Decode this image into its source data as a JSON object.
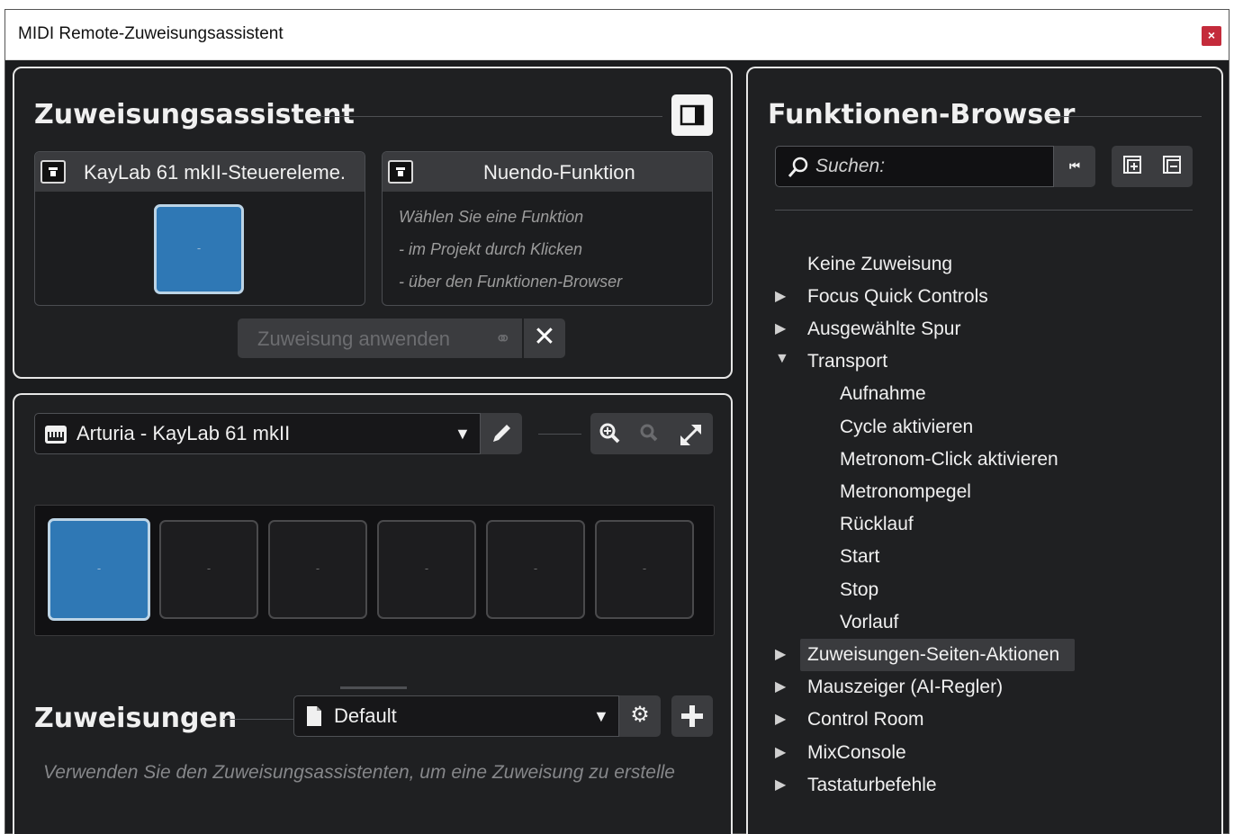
{
  "window": {
    "title": "MIDI Remote-Zuweisungsassistent",
    "close_label": "×"
  },
  "assistant": {
    "title": "Zuweisungsassistent",
    "controller_box": {
      "title": "KayLab 61 mkII-Steuereleme.",
      "pad_value": "-"
    },
    "function_box": {
      "title": "Nuendo-Funktion",
      "hints": [
        "Wählen Sie eine Funktion",
        "- im Projekt durch Klicken",
        "- über den Funktionen-Browser"
      ]
    },
    "apply_label": "Zuweisung anwenden"
  },
  "device": {
    "selected": "Arturia - KayLab 61 mkII",
    "pads": [
      {
        "value": "-",
        "active": true
      },
      {
        "value": "-",
        "active": false
      },
      {
        "value": "-",
        "active": false
      },
      {
        "value": "-",
        "active": false
      },
      {
        "value": "-",
        "active": false
      },
      {
        "value": "-",
        "active": false
      }
    ]
  },
  "mappings": {
    "title": "Zuweisungen",
    "page_selected": "Default",
    "empty_hint": "Verwenden Sie den Zuweisungsassistenten, um eine Zuweisung zu erstelle"
  },
  "browser": {
    "title": "Funktionen-Browser",
    "search_placeholder": "Suchen:",
    "items": [
      {
        "label": "Keine Zuweisung",
        "level": 0,
        "arrow": "none"
      },
      {
        "label": "Focus Quick Controls",
        "level": 0,
        "arrow": "collapsed"
      },
      {
        "label": "Ausgewählte Spur",
        "level": 0,
        "arrow": "collapsed"
      },
      {
        "label": "Transport",
        "level": 0,
        "arrow": "expanded"
      },
      {
        "label": "Aufnahme",
        "level": 1,
        "arrow": "none"
      },
      {
        "label": "Cycle aktivieren",
        "level": 1,
        "arrow": "none"
      },
      {
        "label": "Metronom-Click aktivieren",
        "level": 1,
        "arrow": "none"
      },
      {
        "label": "Metronompegel",
        "level": 1,
        "arrow": "none"
      },
      {
        "label": "Rücklauf",
        "level": 1,
        "arrow": "none"
      },
      {
        "label": "Start",
        "level": 1,
        "arrow": "none"
      },
      {
        "label": "Stop",
        "level": 1,
        "arrow": "none"
      },
      {
        "label": "Vorlauf",
        "level": 1,
        "arrow": "none"
      },
      {
        "label": "Zuweisungen-Seiten-Aktionen",
        "level": 0,
        "arrow": "collapsed",
        "selected": true
      },
      {
        "label": "Mauszeiger (AI-Regler)",
        "level": 0,
        "arrow": "collapsed"
      },
      {
        "label": "Control Room",
        "level": 0,
        "arrow": "collapsed"
      },
      {
        "label": "MixConsole",
        "level": 0,
        "arrow": "collapsed"
      },
      {
        "label": "Tastaturbefehle",
        "level": 0,
        "arrow": "collapsed"
      }
    ]
  },
  "colors": {
    "accent_blue": "#2f78b5",
    "panel_bg": "#1f2022",
    "close_red": "#c42b3b"
  }
}
